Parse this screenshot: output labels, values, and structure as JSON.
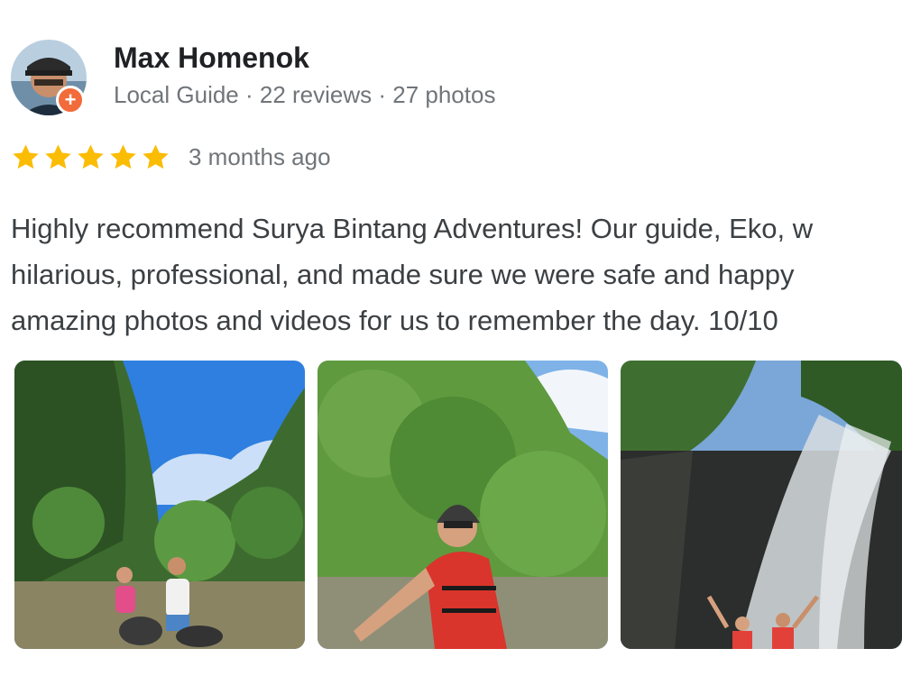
{
  "reviewer": {
    "name": "Max Homenok",
    "meta": "Local Guide · 22 reviews · 27 photos",
    "badge_icon": "local-guide-badge-icon"
  },
  "rating": {
    "stars": 5,
    "max_stars": 5,
    "date": "3 months ago",
    "star_color": "#fbbc04"
  },
  "review": {
    "lines": [
      "Highly recommend Surya Bintang Adventures! Our guide, Eko, w",
      "hilarious, professional, and made sure we were safe and happy",
      "amazing photos and videos for us to remember the day. 10/10"
    ]
  },
  "photos": {
    "items": [
      {
        "subject": "two rafters on a jungle river"
      },
      {
        "subject": "rafter in red life vest and helmet"
      },
      {
        "subject": "rafters under a waterfall"
      }
    ]
  },
  "colors": {
    "name": "#202124",
    "meta": "#70757a",
    "text": "#3c4043",
    "badge": "#f26b3a"
  }
}
